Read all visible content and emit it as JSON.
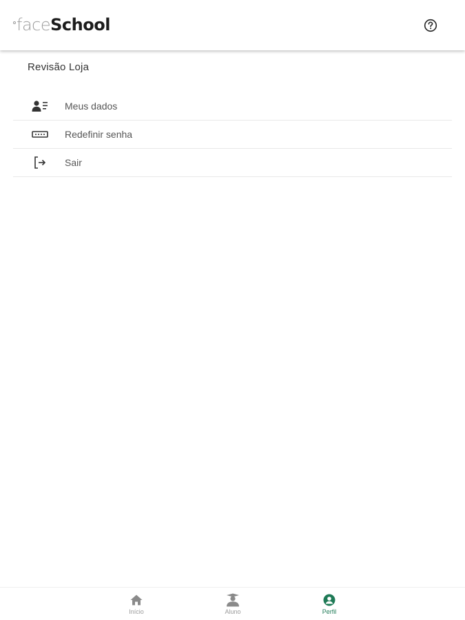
{
  "header": {
    "logo_light": "face",
    "logo_bold": "School",
    "help_icon": "question-circle-icon"
  },
  "profile": {
    "name": "Revisão Loja"
  },
  "menu": {
    "items": [
      {
        "label": "Meus dados",
        "icon": "user-list-icon"
      },
      {
        "label": "Redefinir senha",
        "icon": "password-field-icon"
      },
      {
        "label": "Sair",
        "icon": "logout-icon"
      }
    ]
  },
  "bottom_nav": {
    "items": [
      {
        "label": "Início",
        "icon": "home-icon",
        "active": false
      },
      {
        "label": "Aluno",
        "icon": "student-icon",
        "active": false
      },
      {
        "label": "Perfil",
        "icon": "user-circle-icon",
        "active": true
      }
    ]
  },
  "colors": {
    "accent": "#1e7a56",
    "muted": "#9a9a9a",
    "text": "#333333"
  }
}
